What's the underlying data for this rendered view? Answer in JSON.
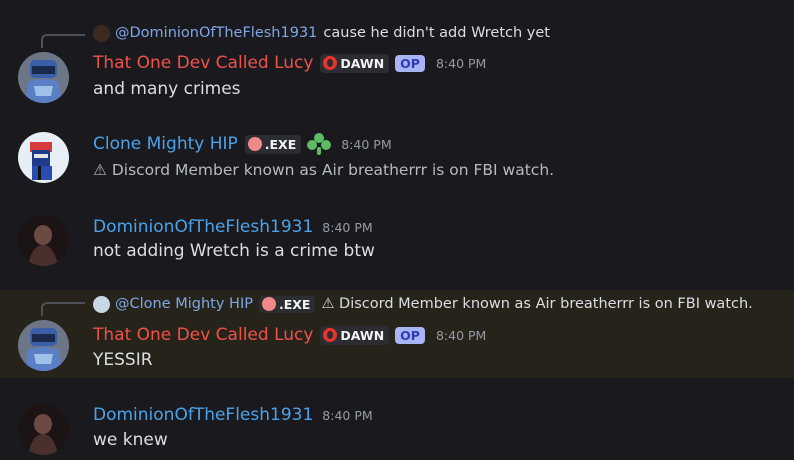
{
  "messages": [
    {
      "reply": {
        "mention": "@DominionOfTheFlesh1931",
        "text": "cause he didn't add Wretch yet"
      },
      "author": "That One Dev Called Lucy",
      "tag": "DAWN",
      "op": "OP",
      "time": "8:40 PM",
      "content": "and many crimes"
    },
    {
      "author": "Clone Mighty HIP",
      "tag": ".EXE",
      "time": "8:40 PM",
      "content": "⚠ Discord Member known as Air breatherrr is on FBI watch."
    },
    {
      "author": "DominionOfTheFlesh1931",
      "time": "8:40 PM",
      "content": "not adding Wretch is a crime btw"
    },
    {
      "reply": {
        "mention": "@Clone Mighty HIP",
        "tag": ".EXE",
        "text": "⚠ Discord Member known as Air breatherrr is on FBI watch."
      },
      "author": "That One Dev Called Lucy",
      "tag": "DAWN",
      "op": "OP",
      "time": "8:40 PM",
      "content": "YESSIR"
    },
    {
      "author": "DominionOfTheFlesh1931",
      "time": "8:40 PM",
      "content": "we knew"
    }
  ],
  "colors": {
    "background": "#1a1a1e",
    "highlight": "#26231b",
    "lucy_name": "#f0524a",
    "blue_name": "#4aa3ea",
    "mention": "#7fa6e6"
  }
}
